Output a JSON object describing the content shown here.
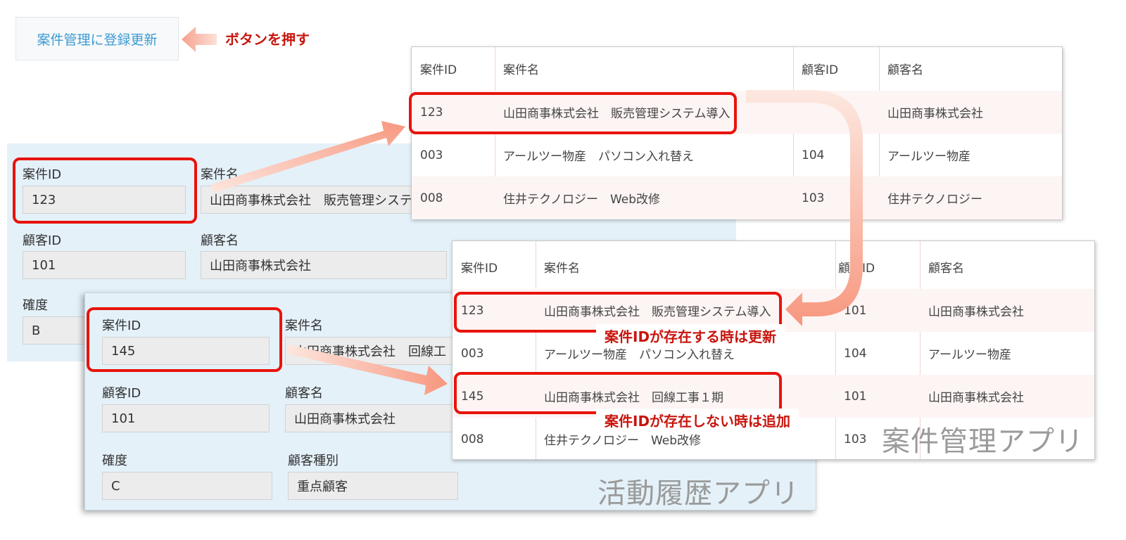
{
  "register_button": {
    "label": "案件管理に登録更新"
  },
  "push_label": "ボタンを押す",
  "activity_app": {
    "name": "活動履歴アプリ",
    "form_back": {
      "project_id_label": "案件ID",
      "project_id": "123",
      "project_name_label": "案件名",
      "project_name": "山田商事株式会社　販売管理システ",
      "customer_id_label": "顧客ID",
      "customer_id": "101",
      "customer_name_label": "顧客名",
      "customer_name": "山田商事株式会社",
      "certainty_label": "確度",
      "certainty": "B"
    },
    "form_front": {
      "project_id_label": "案件ID",
      "project_id": "145",
      "project_name_label": "案件名",
      "project_name": "山田商事株式会社　回線工",
      "customer_id_label": "顧客ID",
      "customer_id": "101",
      "customer_name_label": "顧客名",
      "customer_name": "山田商事株式会社",
      "certainty_label": "確度",
      "certainty": "C",
      "customer_type_label": "顧客種別",
      "customer_type": "重点顧客"
    }
  },
  "project_app": {
    "name": "案件管理アプリ",
    "columns": [
      "案件ID",
      "案件名",
      "顧客ID",
      "顧客名"
    ],
    "table_before": [
      [
        "123",
        "山田商事株式会社　販売管理システム導入",
        "",
        "山田商事株式会社"
      ],
      [
        "003",
        "アールツー物産　パソコン入れ替え",
        "104",
        "アールツー物産"
      ],
      [
        "008",
        "住井テクノロジー　Web改修",
        "103",
        "住井テクノロジー"
      ]
    ],
    "table_after": [
      [
        "123",
        "山田商事株式会社　販売管理システム導入",
        "101",
        "山田商事株式会社"
      ],
      [
        "003",
        "アールツー物産　パソコン入れ替え",
        "104",
        "アールツー物産"
      ],
      [
        "145",
        "山田商事株式会社　回線工事１期",
        "101",
        "山田商事株式会社"
      ],
      [
        "008",
        "住井テクノロジー　Web改修",
        "103",
        ""
      ]
    ],
    "table_after_col3_header": "顧客ID"
  },
  "notes": {
    "update": "案件IDが存在する時は更新",
    "add": "案件IDが存在しない時は追加"
  },
  "colors": {
    "accent_red": "#e8130c",
    "note_red": "#c8150e",
    "form_bg": "#e4f1f9",
    "button_text": "#3d9ad1"
  }
}
